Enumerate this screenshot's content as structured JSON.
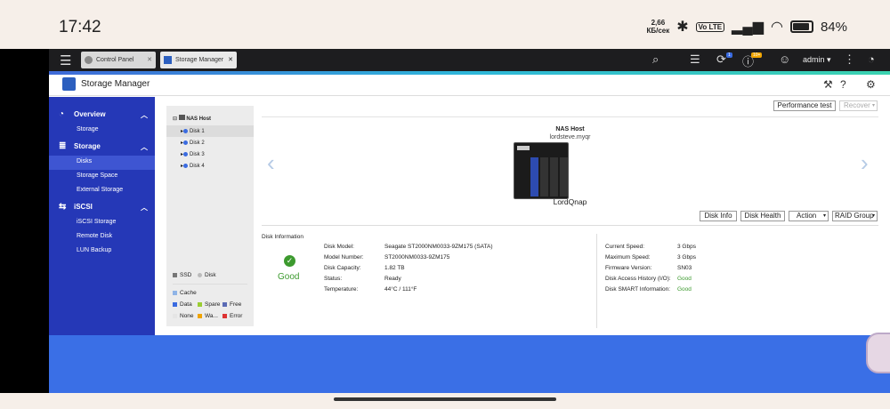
{
  "statusbar": {
    "time": "17:42",
    "speed_value": "2,66",
    "speed_unit": "КБ/сек",
    "volte": "Vo LTE",
    "battery": "84%"
  },
  "topbar": {
    "tabs": [
      {
        "label": "Control Panel"
      },
      {
        "label": "Storage Manager"
      }
    ],
    "user": "admin ▾",
    "badge": "1",
    "notif_badge": "10+"
  },
  "app": {
    "title": "Storage Manager"
  },
  "sidebar": {
    "items": [
      {
        "label": "Overview",
        "type": "section"
      },
      {
        "label": "Storage",
        "type": "item"
      },
      {
        "label": "Storage",
        "type": "section"
      },
      {
        "label": "Disks",
        "type": "item",
        "selected": true
      },
      {
        "label": "Storage Space",
        "type": "item"
      },
      {
        "label": "External Storage",
        "type": "item"
      },
      {
        "label": "iSCSI",
        "type": "section"
      },
      {
        "label": "iSCSI Storage",
        "type": "item"
      },
      {
        "label": "Remote Disk",
        "type": "item"
      },
      {
        "label": "LUN Backup",
        "type": "item"
      }
    ]
  },
  "tree": {
    "root": "NAS Host",
    "disks": [
      "Disk 1",
      "Disk 2",
      "Disk 3",
      "Disk 4"
    ],
    "legend_type": [
      "SSD",
      "Disk"
    ],
    "legend_status": [
      "Cache",
      "Data",
      "Spare",
      "Free",
      "None",
      "Wa...",
      "Error"
    ]
  },
  "toolbar": {
    "performance_test": "Performance test",
    "recover": "Recover"
  },
  "nas": {
    "title": "NAS Host",
    "hostname": "lordsteve.myqr",
    "model_name": "LordQnap"
  },
  "actions": {
    "disk_info": "Disk Info",
    "disk_health": "Disk Health",
    "action": "Action",
    "raid_group": "RAID Group"
  },
  "disk_info": {
    "heading": "Disk Information",
    "status_word": "Good",
    "left_keys": [
      "Disk Model:",
      "Model Number:",
      "Disk Capacity:",
      "Status:",
      "Temperature:"
    ],
    "left_vals": [
      "Seagate ST2000NM0033-9ZM175 (SATA)",
      "ST2000NM0033-9ZM175",
      "1.82 TB",
      "Ready",
      "44°C / 111°F"
    ],
    "right_keys": [
      "Current Speed:",
      "Maximum Speed:",
      "Firmware Version:",
      "Disk Access History (I/O):",
      "Disk SMART Information:"
    ],
    "right_vals": [
      "3 Gbps",
      "3 Gbps",
      "SN03",
      "Good",
      "Good"
    ]
  },
  "colors": {
    "sidebar": "#2538b7",
    "accent": "#3a6fe6",
    "good": "#3c9a2e"
  }
}
